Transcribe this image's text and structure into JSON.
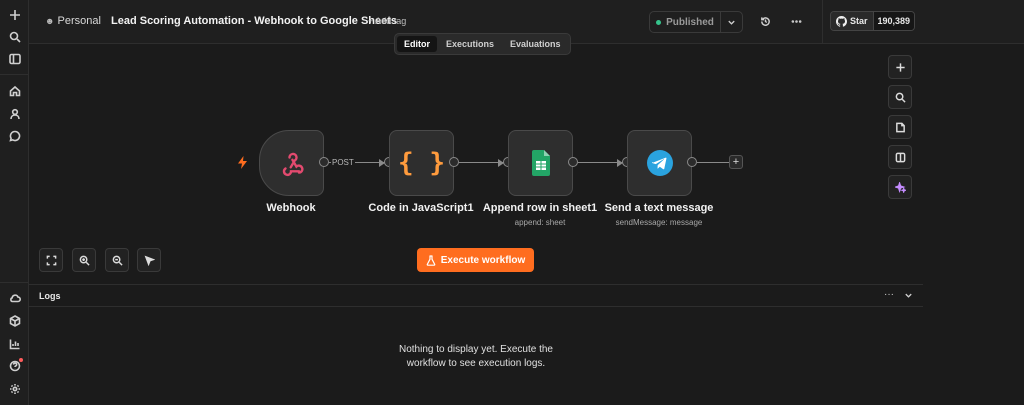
{
  "header": {
    "project": "Personal",
    "workflow_title": "Lead Scoring Automation - Webhook to Google Sheets",
    "add_tag": "+ Add tag",
    "publish_label": "Published",
    "github_star": "Star",
    "github_count": "190,389"
  },
  "tabs": [
    {
      "label": "Editor",
      "active": true
    },
    {
      "label": "Executions",
      "active": false
    },
    {
      "label": "Evaluations",
      "active": false
    }
  ],
  "nodes": [
    {
      "label": "Webhook",
      "subtitle": "",
      "icon": "webhook-icon"
    },
    {
      "label": "Code in JavaScript1",
      "subtitle": "",
      "icon": "code-braces-icon"
    },
    {
      "label": "Append row in sheet1",
      "subtitle": "append: sheet",
      "icon": "google-sheets-icon"
    },
    {
      "label": "Send a text message",
      "subtitle": "sendMessage: message",
      "icon": "telegram-icon"
    }
  ],
  "connection_label": "POST",
  "execute_button": "Execute workflow",
  "logs": {
    "title": "Logs",
    "empty_line1": "Nothing to display yet. Execute the",
    "empty_line2": "workflow to see execution logs."
  },
  "colors": {
    "accent": "#ff6d1f",
    "published_dot": "#35c48c",
    "background": "#1b1b1b"
  }
}
